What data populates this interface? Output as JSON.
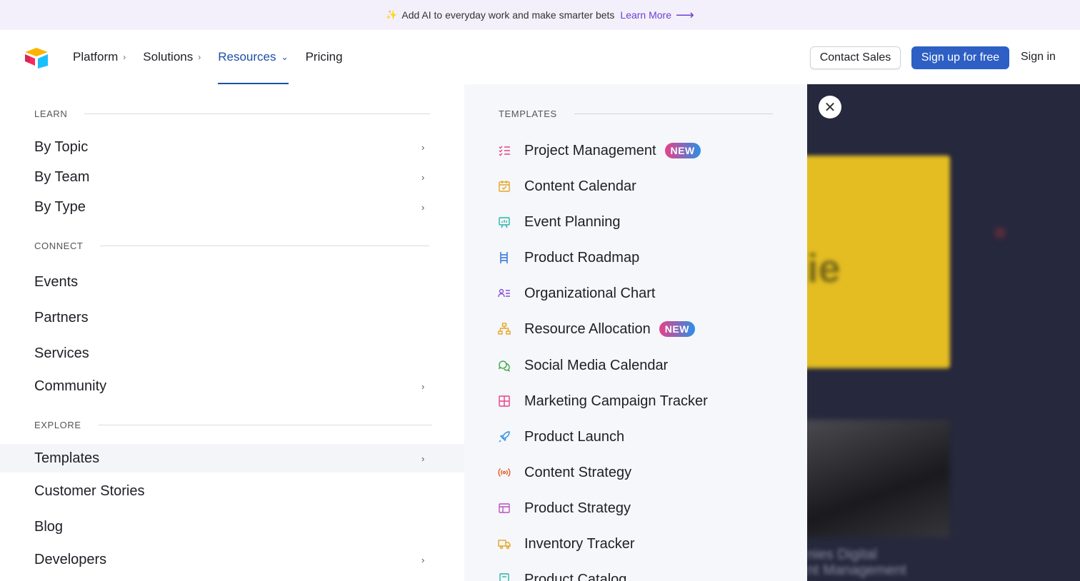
{
  "announcement": {
    "text": "Add AI to everyday work and make smarter bets",
    "link_label": "Learn More",
    "spark_icon": "sparkle-icon"
  },
  "header": {
    "logo_icon": "airtable-logo-icon",
    "nav": [
      {
        "label": "Platform",
        "has_chevron": true,
        "active": false
      },
      {
        "label": "Solutions",
        "has_chevron": true,
        "active": false
      },
      {
        "label": "Resources",
        "has_chevron": true,
        "active": true
      },
      {
        "label": "Pricing",
        "has_chevron": false,
        "active": false
      }
    ],
    "contact_sales": "Contact Sales",
    "sign_up": "Sign up for free",
    "sign_in": "Sign in"
  },
  "menu": {
    "learn": {
      "title": "LEARN",
      "items": [
        {
          "label": "By Topic",
          "chevron": true
        },
        {
          "label": "By Team",
          "chevron": true
        },
        {
          "label": "By Type",
          "chevron": true
        }
      ]
    },
    "connect": {
      "title": "CONNECT",
      "items": [
        {
          "label": "Events",
          "chevron": false
        },
        {
          "label": "Partners",
          "chevron": false
        },
        {
          "label": "Services",
          "chevron": false
        },
        {
          "label": "Community",
          "chevron": true
        }
      ]
    },
    "explore": {
      "title": "EXPLORE",
      "items": [
        {
          "label": "Templates",
          "chevron": true,
          "highlight": true
        },
        {
          "label": "Customer Stories",
          "chevron": false
        },
        {
          "label": "Blog",
          "chevron": false
        },
        {
          "label": "Developers",
          "chevron": true
        }
      ]
    }
  },
  "templates": {
    "title": "TEMPLATES",
    "badge_label": "NEW",
    "items": [
      {
        "label": "Project Management",
        "icon": "checklist-icon",
        "color": "#e8408a",
        "new": true
      },
      {
        "label": "Content Calendar",
        "icon": "calendar-check-icon",
        "color": "#e8a424",
        "new": false
      },
      {
        "label": "Event Planning",
        "icon": "presentation-icon",
        "color": "#2bb3a8",
        "new": false
      },
      {
        "label": "Product Roadmap",
        "icon": "ladder-icon",
        "color": "#2a6fdb",
        "new": false
      },
      {
        "label": "Organizational Chart",
        "icon": "org-list-icon",
        "color": "#8a4fd6",
        "new": false
      },
      {
        "label": "Resource Allocation",
        "icon": "hierarchy-icon",
        "color": "#e8a424",
        "new": true
      },
      {
        "label": "Social Media Calendar",
        "icon": "chat-bubbles-icon",
        "color": "#3aa845",
        "new": false
      },
      {
        "label": "Marketing Campaign Tracker",
        "icon": "grid-icon",
        "color": "#e8408a",
        "new": false
      },
      {
        "label": "Product Launch",
        "icon": "rocket-icon",
        "color": "#2a8fe6",
        "new": false
      },
      {
        "label": "Content Strategy",
        "icon": "broadcast-icon",
        "color": "#e85a24",
        "new": false
      },
      {
        "label": "Product Strategy",
        "icon": "layout-icon",
        "color": "#c04fc0",
        "new": false
      },
      {
        "label": "Inventory Tracker",
        "icon": "truck-icon",
        "color": "#e8a424",
        "new": false
      },
      {
        "label": "Product Catalog",
        "icon": "book-icon",
        "color": "#2bb3a8",
        "new": false
      }
    ]
  },
  "promo": {
    "close_icon": "close-icon",
    "caption_lines": [
      "nies Digital",
      "nt Management"
    ]
  }
}
